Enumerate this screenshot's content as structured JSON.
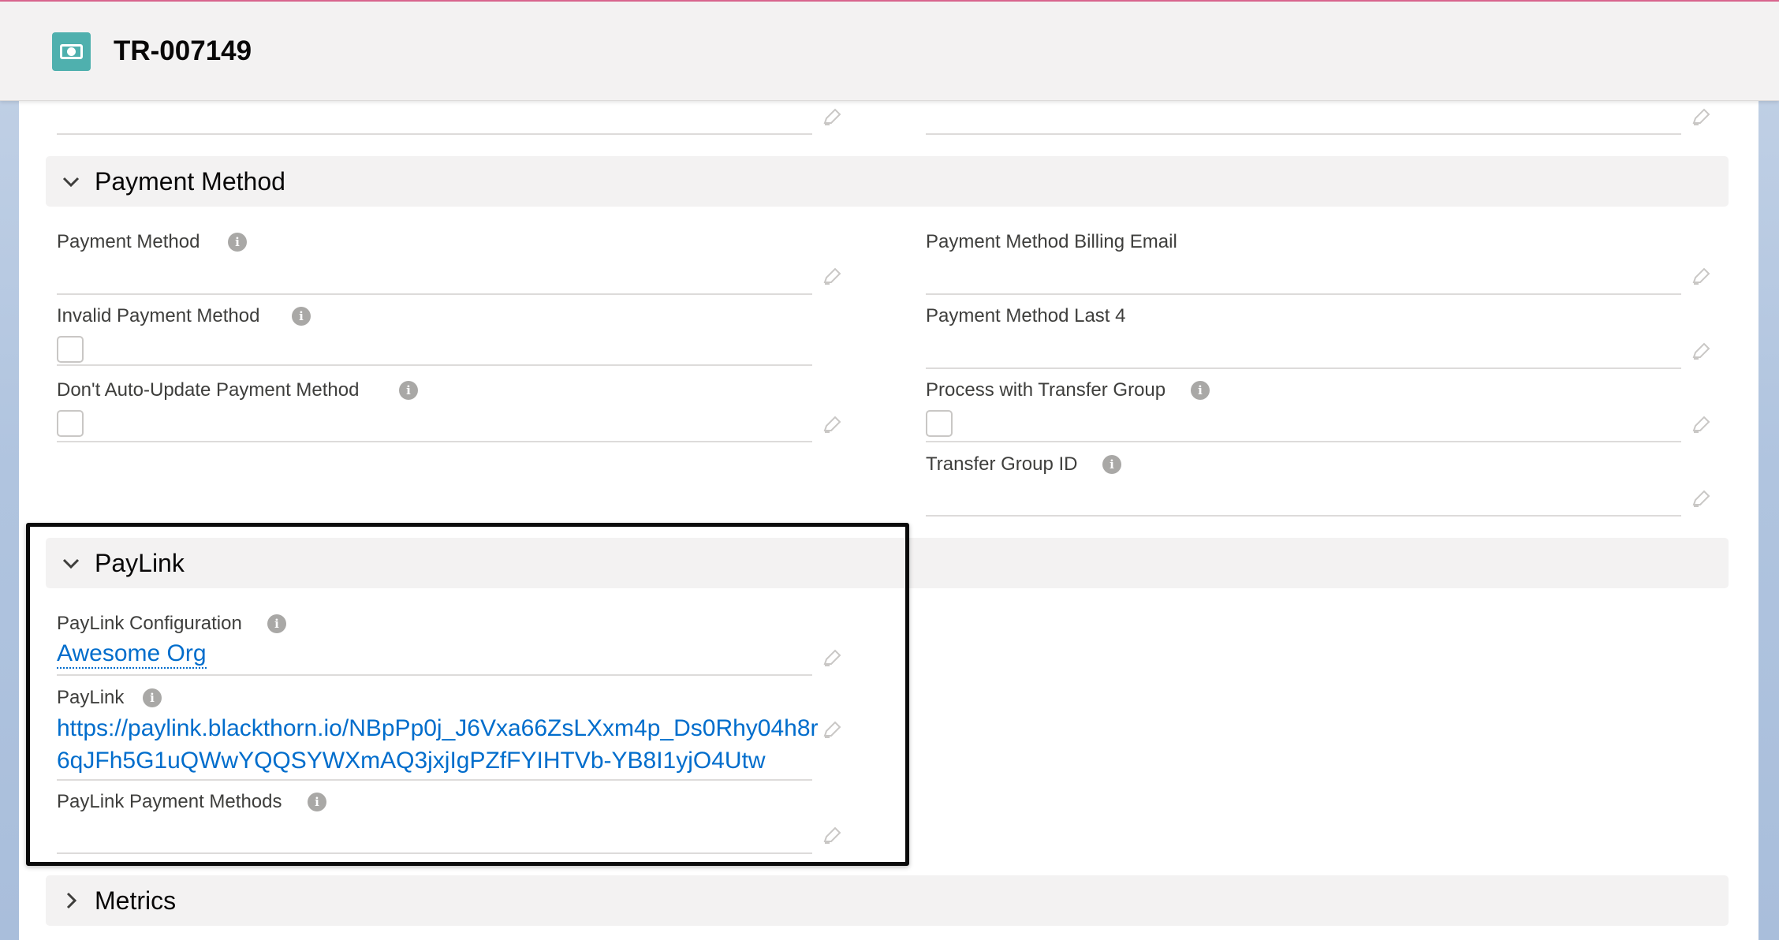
{
  "header": {
    "icon": "payment-record-icon",
    "title": "TR-007149"
  },
  "sections": {
    "payment_method": {
      "title": "Payment Method",
      "fields": {
        "payment_method": {
          "label": "Payment Method",
          "value": ""
        },
        "billing_email": {
          "label": "Payment Method Billing Email",
          "value": ""
        },
        "invalid_payment_method": {
          "label": "Invalid Payment Method",
          "checked": false
        },
        "last_4": {
          "label": "Payment Method Last 4",
          "value": ""
        },
        "dont_auto_update": {
          "label": "Don't Auto-Update Payment Method",
          "checked": false
        },
        "process_with_transfer_group": {
          "label": "Process with Transfer Group",
          "checked": false
        },
        "transfer_group_id": {
          "label": "Transfer Group ID",
          "value": ""
        }
      }
    },
    "paylink": {
      "title": "PayLink",
      "fields": {
        "configuration": {
          "label": "PayLink Configuration",
          "value": "Awesome Org"
        },
        "paylink": {
          "label": "PayLink",
          "value_line1": "https://paylink.blackthorn.io/NBpPp0j_J6Vxa66ZsLXxm4p_Ds0Rhy04h8r",
          "value_line2": "6qJFh5G1uQWwYQQSYWXmAQ3jxjIgPZfFYIHTVb-YB8I1yjO4Utw"
        },
        "payment_methods": {
          "label": "PayLink Payment Methods",
          "value": ""
        }
      }
    },
    "metrics": {
      "title": "Metrics"
    }
  },
  "icons": {
    "info": "i",
    "edit": "pencil-icon",
    "expanded": "chevron-down-icon",
    "collapsed": "chevron-right-icon"
  },
  "colors": {
    "brand_icon": "#4fb0ae",
    "link": "#006dcc",
    "section_bg": "#f3f2f2",
    "highlight_border": "#0a0a0a"
  }
}
